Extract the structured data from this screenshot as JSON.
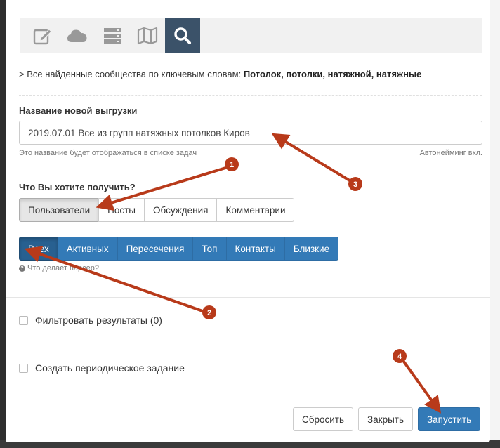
{
  "toolbar": {
    "icons": [
      "edit-icon",
      "cloud-icon",
      "server-icon",
      "map-icon",
      "search-icon"
    ],
    "active": "search-icon",
    "colors": {
      "bar": "#f1f1f1",
      "active": "#3b5269",
      "icon": "#999999"
    }
  },
  "keywords": {
    "prefix": "> Все найденные сообщества по ключевым словам:",
    "terms": "Потолок, потолки, натяжной, натяжные"
  },
  "upload_name": {
    "label": "Название новой выгрузки",
    "value": "2019.07.01 Все из групп натяжных потолков Киров",
    "help": "Это название будет отображаться в списке задач",
    "autoname": "Автонейминг вкл."
  },
  "target": {
    "label": "Что Вы хотите получить?",
    "options": [
      "Пользователи",
      "Посты",
      "Обсуждения",
      "Комментарии"
    ],
    "selected": "Пользователи"
  },
  "mode": {
    "options": [
      "Всех",
      "Активных",
      "Пересечения",
      "Топ",
      "Контакты",
      "Близкие"
    ],
    "selected": "Всех",
    "help": "Что делает парсер?"
  },
  "filter": {
    "label": "Фильтровать результаты (0)",
    "checked": false
  },
  "periodic": {
    "label": "Создать периодическое задание",
    "checked": false
  },
  "footer": {
    "reset": "Сбросить",
    "close": "Закрыть",
    "run": "Запустить"
  },
  "annotations": {
    "badges": [
      "1",
      "2",
      "3",
      "4"
    ],
    "color": "#b83a1a"
  }
}
